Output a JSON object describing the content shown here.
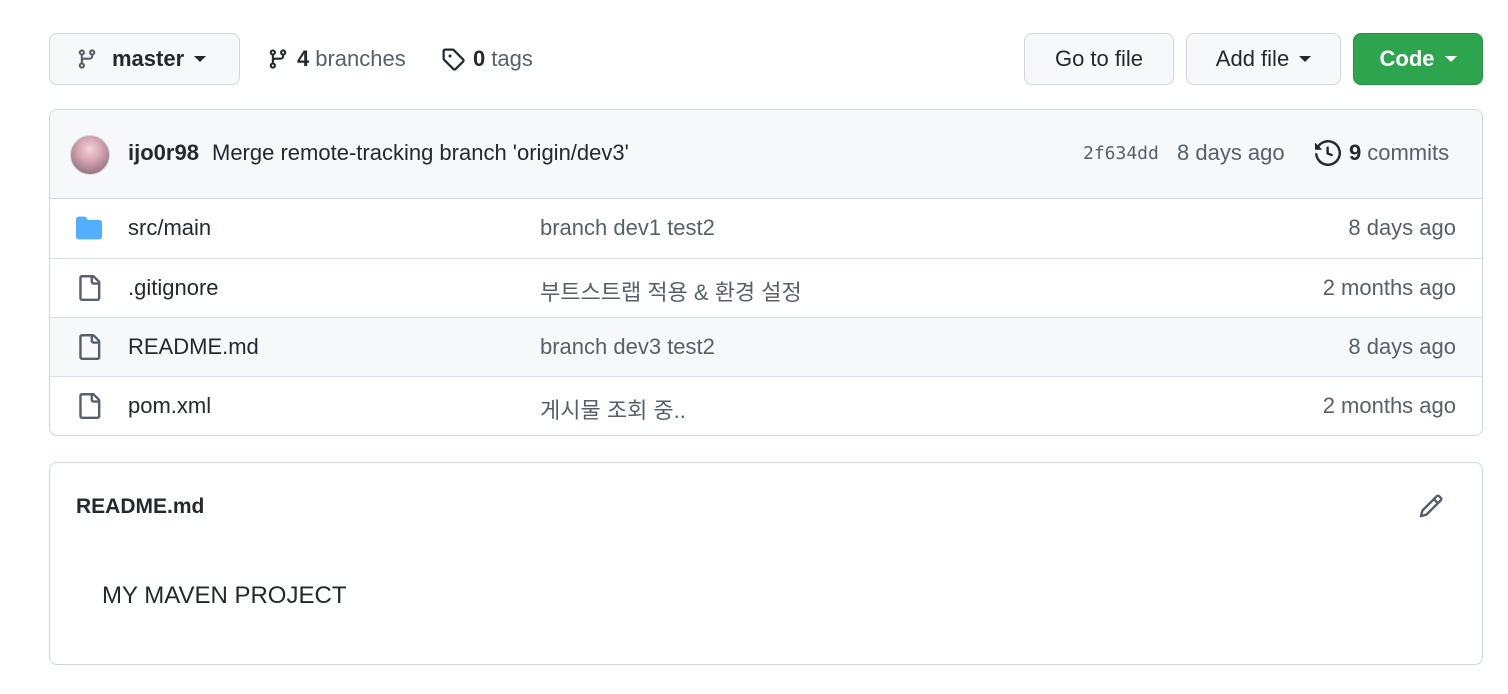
{
  "toolbar": {
    "branch": {
      "icon": "git-branch-icon",
      "label": "master"
    },
    "branches": {
      "icon": "git-branch-icon",
      "count": "4",
      "label": "branches"
    },
    "tags": {
      "icon": "tag-icon",
      "count": "0",
      "label": "tags"
    },
    "goto_file_label": "Go to file",
    "add_file_label": "Add file",
    "code_label": "Code",
    "code_color": "#2da44e"
  },
  "latest_commit": {
    "author": "ijo0r98",
    "message": "Merge remote-tracking branch 'origin/dev3'",
    "sha": "2f634dd",
    "time": "8 days ago",
    "commits_icon": "history-icon",
    "commits_count": "9",
    "commits_label": "commits"
  },
  "files": [
    {
      "type": "dir",
      "icon": "folder-icon",
      "name": "src/main",
      "message": "branch dev1 test2",
      "time": "8 days ago"
    },
    {
      "type": "file",
      "icon": "file-icon",
      "name": ".gitignore",
      "message": "부트스트랩 적용 & 환경 설정",
      "time": "2 months ago"
    },
    {
      "type": "file",
      "icon": "file-icon",
      "name": "README.md",
      "message": "branch dev3 test2",
      "time": "8 days ago"
    },
    {
      "type": "file",
      "icon": "file-icon",
      "name": "pom.xml",
      "message": "게시물 조회 중..",
      "time": "2 months ago"
    }
  ],
  "readme": {
    "title": "README.md",
    "edit_icon": "pencil-icon",
    "body": "MY MAVEN PROJECT"
  },
  "colors": {
    "folder": "#54aeff",
    "border": "#d0d7de",
    "muted": "#57606a",
    "header_bg": "#f6f8fa"
  }
}
